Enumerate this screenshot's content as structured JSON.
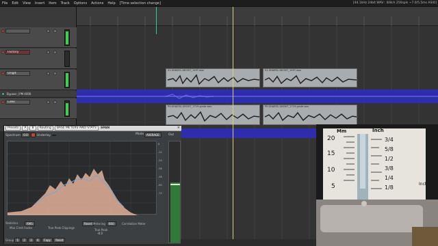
{
  "menu": {
    "items": [
      "File",
      "Edit",
      "View",
      "Insert",
      "Item",
      "Track",
      "Options",
      "Actions",
      "Help"
    ],
    "undo_hint": "[Time selection change]",
    "status_right": "[44.1kHz 24bit WAV : 8/8ch 256spls ~7.0/5.5ms ASIO]"
  },
  "tracks": [
    {
      "name": "",
      "meter_level": 0.85
    },
    {
      "name": "Factory",
      "subtext": "",
      "meter_level": 0.0
    },
    {
      "name": "Origit",
      "meter_level": 0.9
    },
    {
      "name": "Bypass | PM 4000",
      "meter_level": 0.0
    },
    {
      "name": "Lider",
      "meter_level": 0.8
    }
  ],
  "items": [
    {
      "name": "01-SHAESS-180307_1497.wav"
    },
    {
      "name": "01-SHAESS-180307_1497.wav"
    },
    {
      "name": "PH-SHAESS-180307_1719-gnste.wav"
    },
    {
      "name": "PH-SHAESS-180307_1719-gnste.wav"
    }
  ],
  "span": {
    "title": "SPAN",
    "presets_label": "Presets",
    "preset_buttons": [
      "A",
      "B"
    ],
    "routing_label": "Routing",
    "preset_name": "BASE METERS AND STATS",
    "spectrum_label": "Spectrum",
    "spectrum_value": "0.0",
    "underlay_label": "Underlay",
    "underlay_value": "",
    "mode_label": "Mode",
    "mode_value": "AVERAGE",
    "out_label": "Out",
    "scale_ticks": [
      "0",
      "-6",
      "-12",
      "-18",
      "-24",
      "-30",
      "-36",
      "-42",
      "-48",
      "-54",
      "-60",
      "-66",
      "-72"
    ],
    "freq_ticks": [
      "20",
      "50",
      "100",
      "200",
      "500",
      "1k",
      "2k",
      "5k",
      "10k",
      "20k"
    ],
    "stats_label": "Statistics",
    "rms_label": "RMS",
    "max_crest_label": "Max Crest Factor",
    "true_peak_clippings_label": "True Peak Clippings",
    "true_peak_label": "True Peak",
    "reset_label": "Reset",
    "metering_label": "Metering",
    "metering_value": "600",
    "correlation_label": "Correlation Meter",
    "true_peak_value": "-0.3",
    "group_label": "Group",
    "group_buttons": [
      "1",
      "2",
      "3",
      "4"
    ],
    "group_actions": [
      "Copy",
      "Reset"
    ]
  },
  "ruler": {
    "timecodes": [
      "",
      "",
      "",
      "",
      "",
      "",
      "",
      ""
    ]
  },
  "cam": {
    "scale_mm": "Mm",
    "scale_inch": "Inch",
    "mm_ticks": [
      "20",
      "15",
      "10",
      "5"
    ],
    "inch_ticks": [
      "3/4",
      "5/8",
      "1/2",
      "3/8",
      "1/4",
      "1/8"
    ],
    "inch_side": [
      "Inch",
      ".040",
      ".030",
      ".020",
      ".010"
    ],
    "inch_bottom": "Inch"
  },
  "colors": {
    "bus_lane": "#2d2dae",
    "meter_green": "#3fcf4f",
    "spectrum_peach": "#e3b19b",
    "spectrum_blue": "#7aa6d6",
    "cursor": "#d8cf7a"
  }
}
